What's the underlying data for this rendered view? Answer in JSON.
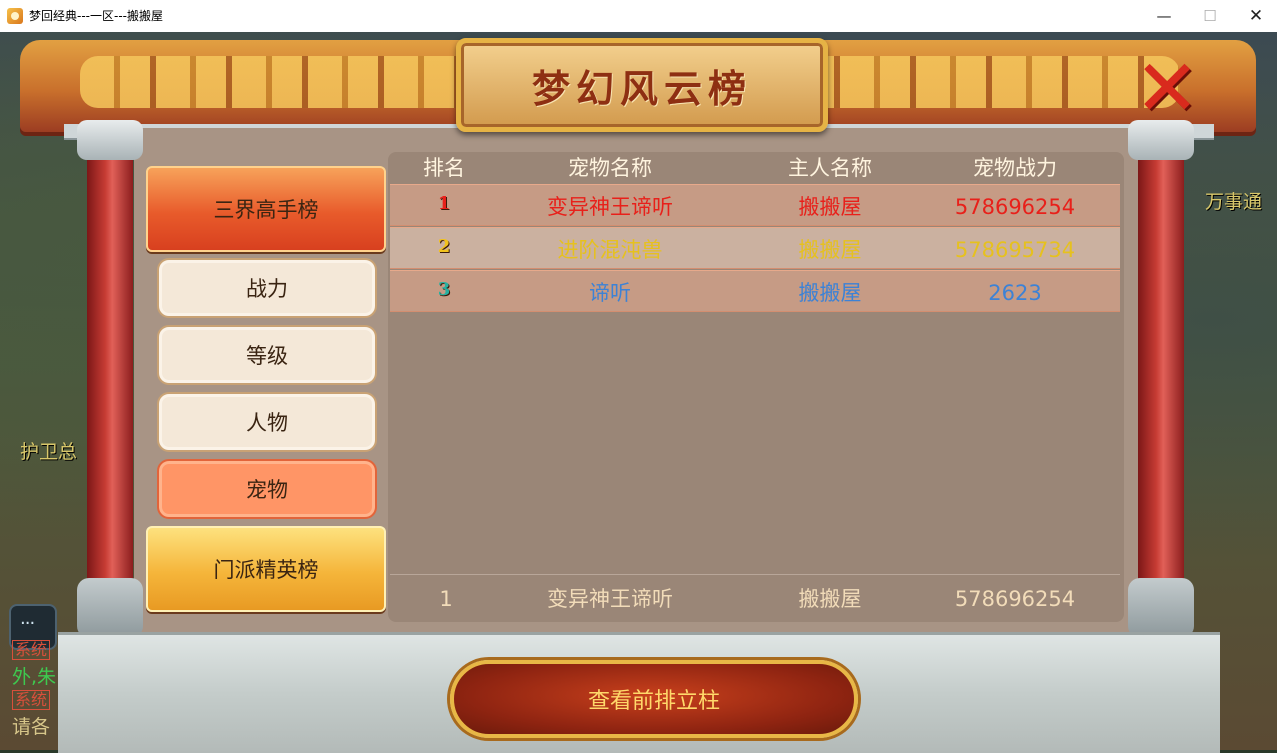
{
  "window": {
    "title": "梦回经典---一区---搬搬屋",
    "minimize": "—",
    "maximize": "☐",
    "close": "✕"
  },
  "game": {
    "npc_right": "万事通",
    "npc_left": "护卫总",
    "chat": [
      {
        "tag": "系统",
        "text": "外,朱",
        "color": "#3ec94f"
      },
      {
        "tag": "系统",
        "text": "请各",
        "color": "#d7c68a"
      }
    ]
  },
  "panel": {
    "title": "梦幻风云榜",
    "close_icon": "close-x-icon",
    "categories": [
      "三界高手榜",
      "门派精英榜"
    ],
    "subtabs": [
      "战力",
      "等级",
      "人物",
      "宠物"
    ],
    "active_subtab": "宠物",
    "table": {
      "headers": [
        "排名",
        "宠物名称",
        "主人名称",
        "宠物战力"
      ],
      "rows": [
        {
          "rank": "1",
          "pet": "变异神王谛听",
          "owner": "搬搬屋",
          "power": "578696254",
          "color": "#e8201a",
          "rank_color": "#e8201a"
        },
        {
          "rank": "2",
          "pet": "进阶混沌兽",
          "owner": "搬搬屋",
          "power": "578695734",
          "color": "#e6c11e",
          "rank_color": "#f2c21c"
        },
        {
          "rank": "3",
          "pet": "谛听",
          "owner": "搬搬屋",
          "power": "2623",
          "color": "#3c82d6",
          "rank_color": "#27b0a0"
        }
      ],
      "my_rank": {
        "rank": "1",
        "pet": "变异神王谛听",
        "owner": "搬搬屋",
        "power": "578696254"
      }
    },
    "bottom_button": "查看前排立柱"
  }
}
